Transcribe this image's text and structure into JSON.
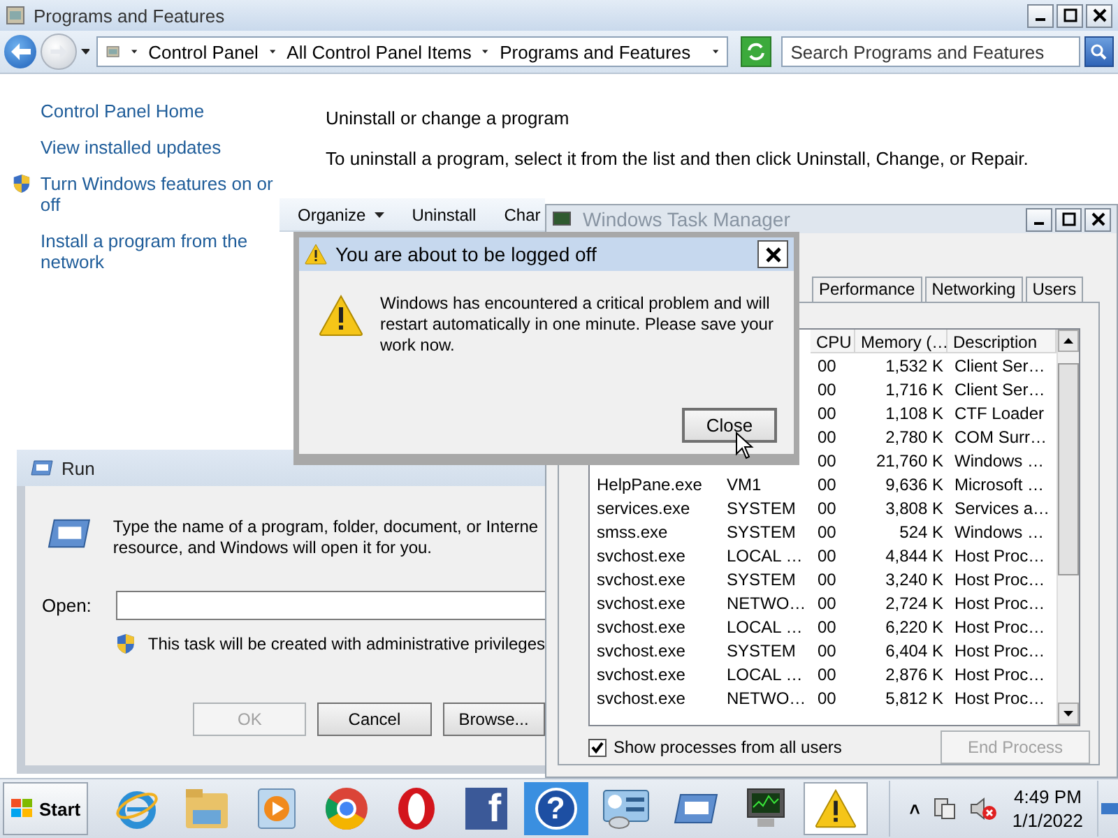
{
  "programs_window": {
    "title": "Programs and Features",
    "address_bar": {
      "crumbs": [
        "Control Panel",
        "All Control Panel Items",
        "Programs and Features"
      ]
    },
    "search": {
      "placeholder": "Search Programs and Features"
    },
    "sidebar": {
      "links": [
        {
          "label": "Control Panel Home",
          "shield": false
        },
        {
          "label": "View installed updates",
          "shield": false
        },
        {
          "label": "Turn Windows features on or off",
          "shield": true
        },
        {
          "label": "Install a program from the network",
          "shield": false
        }
      ]
    },
    "heading": "Uninstall or change a program",
    "instruction": "To uninstall a program, select it from the list and then click Uninstall, Change, or Repair.",
    "toolbar": [
      {
        "label": "Organize",
        "menu": true
      },
      {
        "label": "Uninstall",
        "menu": false
      },
      {
        "label": "Char",
        "menu": false
      }
    ]
  },
  "task_manager": {
    "title": "Windows Task Manager",
    "tabs": [
      {
        "label": "Performance",
        "selected": false
      },
      {
        "label": "Networking",
        "selected": false
      },
      {
        "label": "Users",
        "selected": false
      }
    ],
    "columns": [
      "CPU",
      "Memory (…",
      "Description"
    ],
    "rows": [
      {
        "cpu": "00",
        "memory": "1,532 K",
        "description": "Client Ser…"
      },
      {
        "cpu": "00",
        "memory": "1,716 K",
        "description": "Client Ser…"
      },
      {
        "cpu": "00",
        "memory": "1,108 K",
        "description": "CTF Loader"
      },
      {
        "cpu": "00",
        "memory": "2,780 K",
        "description": "COM Surr…"
      },
      {
        "cpu": "00",
        "memory": "21,760 K",
        "description": "Windows …"
      },
      {
        "image": "HelpPane.exe",
        "user": "VM1",
        "cpu": "00",
        "memory": "9,636 K",
        "description": "Microsoft …"
      },
      {
        "image": "services.exe",
        "user": "SYSTEM",
        "cpu": "00",
        "memory": "3,808 K",
        "description": "Services a…"
      },
      {
        "image": "smss.exe",
        "user": "SYSTEM",
        "cpu": "00",
        "memory": "524 K",
        "description": "Windows …"
      },
      {
        "image": "svchost.exe",
        "user": "LOCAL …",
        "cpu": "00",
        "memory": "4,844 K",
        "description": "Host Proc…"
      },
      {
        "image": "svchost.exe",
        "user": "SYSTEM",
        "cpu": "00",
        "memory": "3,240 K",
        "description": "Host Proc…"
      },
      {
        "image": "svchost.exe",
        "user": "NETWO…",
        "cpu": "00",
        "memory": "2,724 K",
        "description": "Host Proc…"
      },
      {
        "image": "svchost.exe",
        "user": "LOCAL …",
        "cpu": "00",
        "memory": "6,220 K",
        "description": "Host Proc…"
      },
      {
        "image": "svchost.exe",
        "user": "SYSTEM",
        "cpu": "00",
        "memory": "6,404 K",
        "description": "Host Proc…"
      },
      {
        "image": "svchost.exe",
        "user": "LOCAL …",
        "cpu": "00",
        "memory": "2,876 K",
        "description": "Host Proc…"
      },
      {
        "image": "svchost.exe",
        "user": "NETWO…",
        "cpu": "00",
        "memory": "5,812 K",
        "description": "Host Proc…"
      }
    ],
    "show_all_users": {
      "label": "Show processes from all users",
      "checked": true
    },
    "end_process": {
      "label": "End Process",
      "disabled": true
    }
  },
  "logoff_dialog": {
    "title": "You are about to be logged off",
    "message": "Windows has encountered a critical problem and will restart automatically in one minute. Please save your work now.",
    "button": "Close"
  },
  "run_dialog": {
    "title": "Run",
    "description": "Type the name of a program, folder, document, or Interne resource, and Windows will open it for you.",
    "open_label": "Open:",
    "admin_note": "This task will be created with administrative privileges",
    "buttons": [
      {
        "label": "OK",
        "disabled": true
      },
      {
        "label": "Cancel",
        "disabled": false
      },
      {
        "label": "Browse...",
        "disabled": false
      }
    ]
  },
  "taskbar": {
    "start": "Start",
    "apps": [
      {
        "kind": "ie",
        "selected": false
      },
      {
        "kind": "folder",
        "selected": false
      },
      {
        "kind": "media",
        "selected": false
      },
      {
        "kind": "chrome",
        "selected": false
      },
      {
        "kind": "opera",
        "selected": false
      },
      {
        "kind": "facebook",
        "glyph": "f",
        "selected": false
      },
      {
        "kind": "help",
        "glyph": "?",
        "selected": false,
        "hot": true
      },
      {
        "kind": "control-panel",
        "selected": false
      },
      {
        "kind": "run",
        "selected": false
      },
      {
        "kind": "task-manager",
        "selected": false
      },
      {
        "kind": "warning",
        "selected": true
      }
    ],
    "tray": {
      "expand": "˄"
    },
    "clock": {
      "time": "4:49 PM",
      "date": "1/1/2022"
    }
  }
}
